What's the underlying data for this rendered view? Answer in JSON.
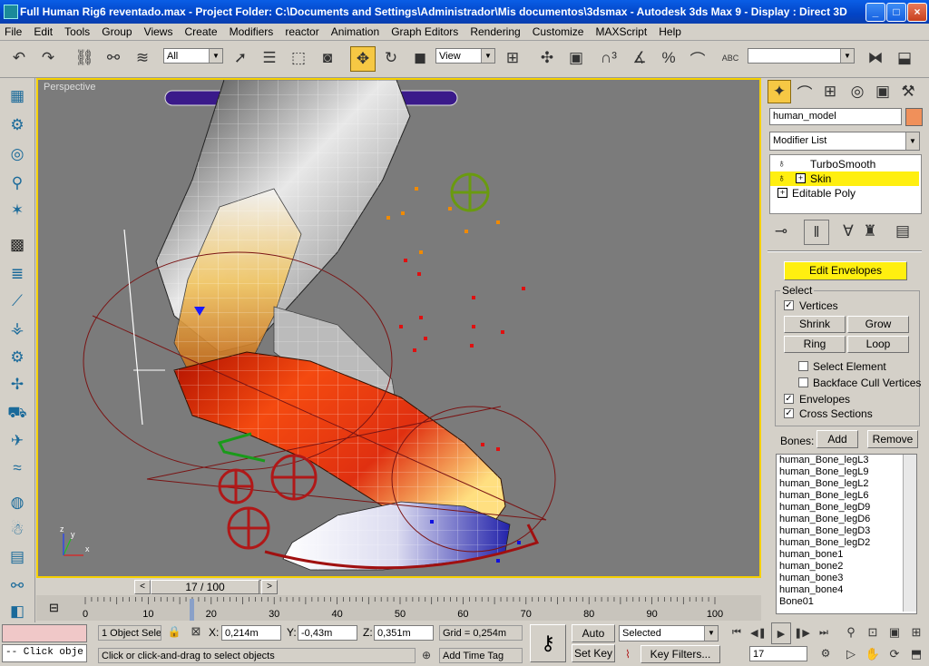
{
  "window": {
    "title": "Full Human Rig6 reventado.max     - Project Folder: C:\\Documents and Settings\\Administrador\\Mis documentos\\3dsmax     - Autodesk 3ds Max 9     - Display : Direct 3D",
    "min": "_",
    "max": "□",
    "close": "×"
  },
  "menu": [
    "File",
    "Edit",
    "Tools",
    "Group",
    "Views",
    "Create",
    "Modifiers",
    "reactor",
    "Animation",
    "Graph Editors",
    "Rendering",
    "Customize",
    "MAXScript",
    "Help"
  ],
  "toolbar": {
    "selection_filter": "All",
    "ref_coord": "View",
    "named_selection": "",
    "abc_label": "ABC"
  },
  "viewport": {
    "label": "Perspective",
    "axis_x": "x",
    "axis_y": "y",
    "axis_z": "z"
  },
  "cmdpanel": {
    "object_name": "human_model",
    "modifier_list": "Modifier List",
    "stack": [
      {
        "label": "TurboSmooth",
        "selected": false
      },
      {
        "label": "Skin",
        "selected": true
      },
      {
        "label": "Editable Poly",
        "selected": false
      }
    ],
    "edit_envelopes": "Edit Envelopes",
    "select_group": "Select",
    "vertices": "Vertices",
    "shrink": "Shrink",
    "grow": "Grow",
    "ring": "Ring",
    "loop": "Loop",
    "select_element": "Select Element",
    "backface_cull": "Backface Cull Vertices",
    "envelopes": "Envelopes",
    "cross_sections": "Cross Sections",
    "bones_label": "Bones:",
    "add": "Add",
    "remove": "Remove",
    "bones": [
      "human_Bone_legL3",
      "human_Bone_legL9",
      "human_Bone_legL2",
      "human_Bone_legL6",
      "human_Bone_legD9",
      "human_Bone_legD6",
      "human_Bone_legD3",
      "human_Bone_legD2",
      "human_bone1",
      "human_bone2",
      "human_bone3",
      "human_bone4",
      "Bone01"
    ]
  },
  "timeline": {
    "frame": "17 / 100",
    "prev": "<",
    "next": ">",
    "ticks": [
      "0",
      "10",
      "20",
      "30",
      "40",
      "50",
      "60",
      "70",
      "80",
      "90",
      "100"
    ]
  },
  "status": {
    "maxscript": "-- Click obje",
    "selection": "1 Object Sele",
    "x_label": "X:",
    "x": "0,214m",
    "y_label": "Y:",
    "y": "-0,43m",
    "z_label": "Z:",
    "z": "0,351m",
    "grid": "Grid = 0,254m",
    "prompt": "Click or click-and-drag to select objects",
    "add_time_tag": "Add Time Tag",
    "auto_key": "Auto Key",
    "set_key": "Set Key",
    "selected": "Selected",
    "key_filters": "Key Filters...",
    "current_frame": "17"
  }
}
